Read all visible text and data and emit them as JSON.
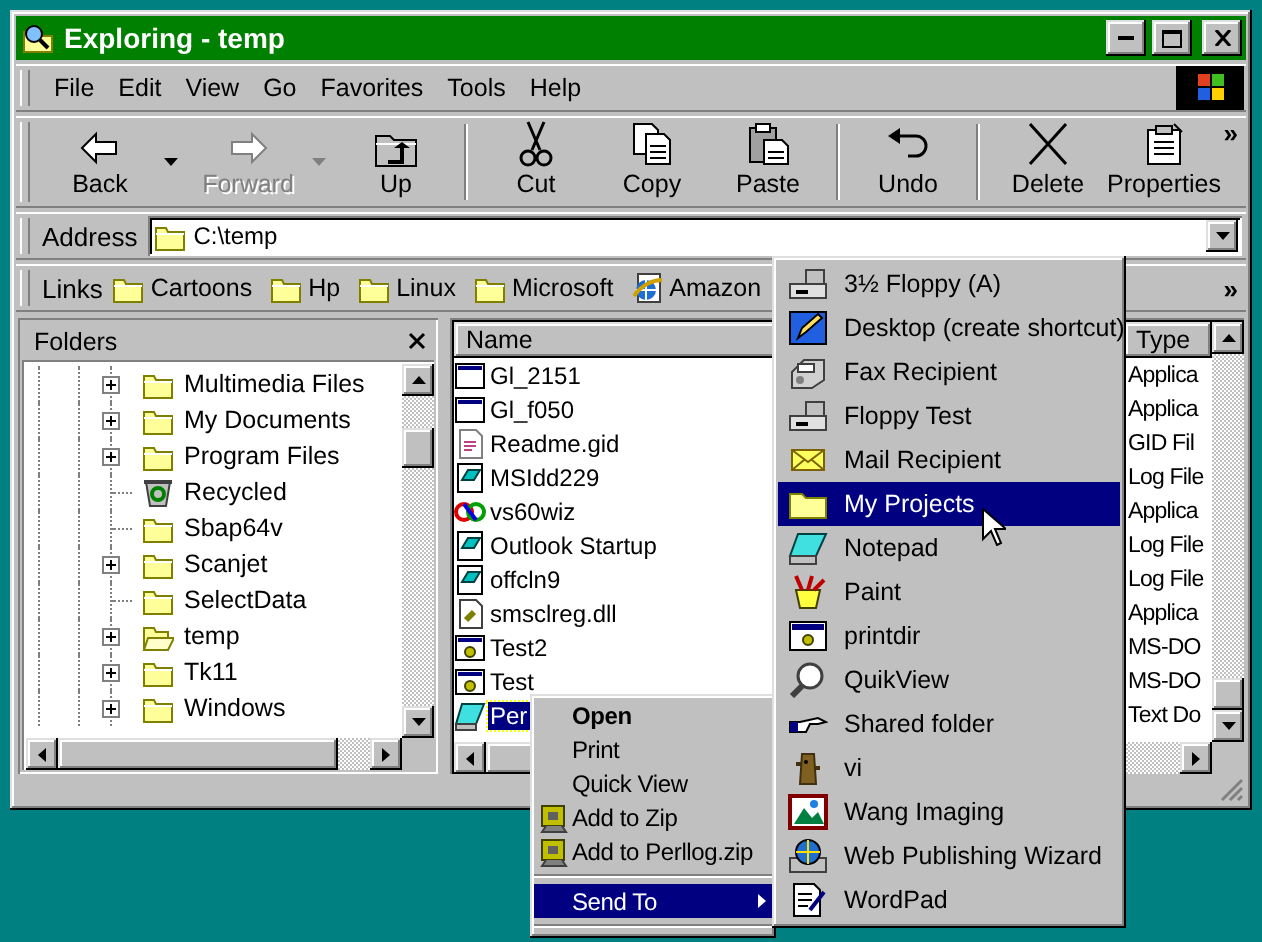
{
  "window": {
    "title": "Exploring - temp"
  },
  "menu_bar": [
    "File",
    "Edit",
    "View",
    "Go",
    "Favorites",
    "Tools",
    "Help"
  ],
  "toolbar": {
    "groups": [
      [
        {
          "label": "Back",
          "disabled": false,
          "dropdown": true
        },
        {
          "label": "Forward",
          "disabled": true,
          "dropdown": true
        },
        {
          "label": "Up",
          "disabled": false,
          "dropdown": false
        }
      ],
      [
        {
          "label": "Cut",
          "disabled": false,
          "dropdown": false
        },
        {
          "label": "Copy",
          "disabled": false,
          "dropdown": false
        },
        {
          "label": "Paste",
          "disabled": false,
          "dropdown": false
        }
      ],
      [
        {
          "label": "Undo",
          "disabled": false,
          "dropdown": false
        }
      ],
      [
        {
          "label": "Delete",
          "disabled": false,
          "dropdown": false
        },
        {
          "label": "Properties",
          "disabled": false,
          "dropdown": false
        }
      ]
    ],
    "overflow": "»"
  },
  "address_bar": {
    "label": "Address",
    "value": "C:\\temp"
  },
  "links_bar": {
    "label": "Links",
    "overflow": "»",
    "links": [
      {
        "label": "Cartoons",
        "kind": "folder"
      },
      {
        "label": "Hp",
        "kind": "folder"
      },
      {
        "label": "Linux",
        "kind": "folder"
      },
      {
        "label": "Microsoft",
        "kind": "folder"
      },
      {
        "label": "Amazon",
        "kind": "web"
      }
    ]
  },
  "folders_pane": {
    "title": "Folders",
    "items": [
      {
        "name": "Multimedia Files",
        "kind": "folder",
        "expandable": true
      },
      {
        "name": "My Documents",
        "kind": "folder",
        "expandable": true
      },
      {
        "name": "Program Files",
        "kind": "folder",
        "expandable": true
      },
      {
        "name": "Recycled",
        "kind": "recycle-bin",
        "expandable": false
      },
      {
        "name": "Sbap64v",
        "kind": "folder",
        "expandable": false
      },
      {
        "name": "Scanjet",
        "kind": "folder",
        "expandable": true
      },
      {
        "name": "SelectData",
        "kind": "folder",
        "expandable": false
      },
      {
        "name": "temp",
        "kind": "open-folder",
        "expandable": true
      },
      {
        "name": "Tk11",
        "kind": "folder",
        "expandable": true
      },
      {
        "name": "Windows",
        "kind": "folder",
        "expandable": true
      }
    ]
  },
  "file_list": {
    "columns": [
      "Name",
      "Type"
    ],
    "rows": [
      {
        "name": "Gl_2151",
        "type": "Applica",
        "selected": false
      },
      {
        "name": "Gl_f050",
        "type": "Applica",
        "selected": false
      },
      {
        "name": "Readme.gid",
        "type": "GID Fil",
        "selected": false
      },
      {
        "name": "MSIdd229",
        "type": "Log File",
        "selected": false
      },
      {
        "name": "vs60wiz",
        "type": "Applica",
        "selected": false
      },
      {
        "name": "Outlook Startup",
        "type": "Log File",
        "selected": false
      },
      {
        "name": "offcln9",
        "type": "Log File",
        "selected": false
      },
      {
        "name": "smsclreg.dll",
        "type": "Applica",
        "selected": false
      },
      {
        "name": "Test2",
        "type": "MS-DO",
        "selected": false
      },
      {
        "name": "Test",
        "type": "MS-DO",
        "selected": false
      },
      {
        "name": "Per",
        "type": "Text Do",
        "selected": true
      }
    ]
  },
  "context_menu": {
    "items": [
      {
        "kind": "command",
        "label": "Open",
        "default": true,
        "selected": false
      },
      {
        "kind": "command",
        "label": "Print",
        "default": false,
        "selected": false
      },
      {
        "kind": "command",
        "label": "Quick View",
        "default": false,
        "selected": false
      },
      {
        "kind": "archive-command",
        "label": "Add to Zip",
        "default": false,
        "selected": false
      },
      {
        "kind": "archive-command",
        "label": "Add to Perllog.zip",
        "default": false,
        "selected": false
      },
      {
        "kind": "separator"
      },
      {
        "kind": "submenu",
        "label": "Send To",
        "default": false,
        "selected": true
      },
      {
        "kind": "separator"
      }
    ]
  },
  "send_to_menu": {
    "items": [
      {
        "label": "3½ Floppy (A)",
        "selected": false
      },
      {
        "label": "Desktop (create shortcut)",
        "selected": false
      },
      {
        "label": "Fax Recipient",
        "selected": false
      },
      {
        "label": "Floppy Test",
        "selected": false
      },
      {
        "label": "Mail Recipient",
        "selected": false
      },
      {
        "label": "My Projects",
        "selected": true
      },
      {
        "label": "Notepad",
        "selected": false
      },
      {
        "label": "Paint",
        "selected": false
      },
      {
        "label": "printdir",
        "selected": false
      },
      {
        "label": "QuikView",
        "selected": false
      },
      {
        "label": "Shared folder",
        "selected": false
      },
      {
        "label": "vi",
        "selected": false
      },
      {
        "label": "Wang Imaging",
        "selected": false
      },
      {
        "label": "Web Publishing Wizard",
        "selected": false
      },
      {
        "label": "WordPad",
        "selected": false
      }
    ]
  }
}
